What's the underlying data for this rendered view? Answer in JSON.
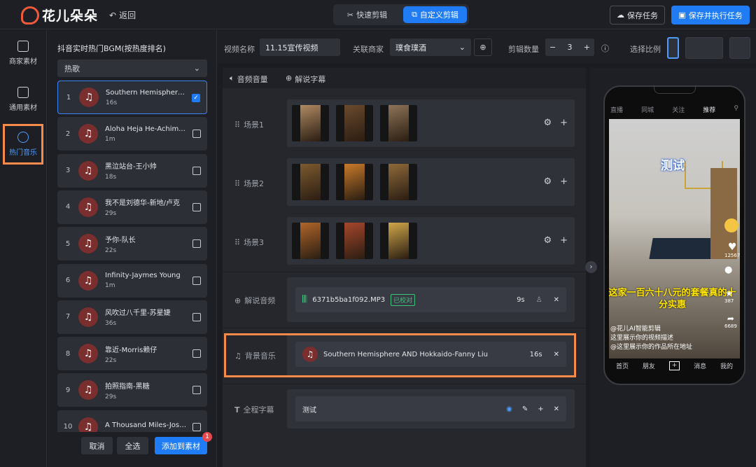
{
  "header": {
    "app_name": "花儿朵朵",
    "back_label": "返回",
    "mode_tabs": [
      {
        "label": "快速剪辑",
        "active": false
      },
      {
        "label": "自定义剪辑",
        "active": true
      }
    ],
    "save_label": "保存任务",
    "save_run_label": "保存并执行任务"
  },
  "nav": [
    {
      "label": "商家素材",
      "icon": "play-icon",
      "active": false
    },
    {
      "label": "通用素材",
      "icon": "video-icon",
      "active": false
    },
    {
      "label": "热门音乐",
      "icon": "music-disc-icon",
      "active": true
    }
  ],
  "music_panel": {
    "title": "抖音实时热门BGM(按热度排名)",
    "genre_value": "热歌",
    "tracks": [
      {
        "index": "1",
        "name": "Southern Hemisphere...",
        "duration": "16s",
        "checked": true
      },
      {
        "index": "2",
        "name": "Aloha Heja He-Achim...",
        "duration": "1m",
        "checked": false
      },
      {
        "index": "3",
        "name": "黑泣站台-王小帅",
        "duration": "18s",
        "checked": false
      },
      {
        "index": "4",
        "name": "我不是刘德华-新地/卢克",
        "duration": "29s",
        "checked": false
      },
      {
        "index": "5",
        "name": "予你-队长",
        "duration": "22s",
        "checked": false
      },
      {
        "index": "6",
        "name": "Infinity-Jaymes Young",
        "duration": "1m",
        "checked": false
      },
      {
        "index": "7",
        "name": "风吹过八千里-苏星婕",
        "duration": "36s",
        "checked": false
      },
      {
        "index": "8",
        "name": "靠近-Morris赖仔",
        "duration": "22s",
        "checked": false
      },
      {
        "index": "9",
        "name": "拍照指南-黑糖",
        "duration": "29s",
        "checked": false
      },
      {
        "index": "10",
        "name": "A Thousand Miles-Josh...",
        "duration": "",
        "checked": false
      }
    ],
    "cancel_label": "取消",
    "select_all_label": "全选",
    "add_label": "添加到素材",
    "add_badge": "1"
  },
  "toolbar": {
    "video_name_label": "视频名称",
    "video_name_value": "11.15宣传视频",
    "merchant_label": "关联商家",
    "merchant_value": "璞食璞酒",
    "count_label": "剪辑数量",
    "count_value": "3",
    "ratio_label": "选择比例"
  },
  "editor": {
    "tab_audio": "音频音量",
    "tab_subtitle": "解说字幕",
    "scenes": [
      {
        "label": "场景1"
      },
      {
        "label": "场景2"
      },
      {
        "label": "场景3"
      }
    ],
    "narration_label": "解说音频",
    "narration_file": "6371b5ba1f092.MP3",
    "narration_status": "已校对",
    "narration_duration": "9s",
    "bgm_label": "背景音乐",
    "bgm_name": "Southern Hemisphere AND Hokkaido-Fanny Liu",
    "bgm_duration": "16s",
    "subtitle_label": "全程字幕",
    "subtitle_value": "测试"
  },
  "preview": {
    "top_tabs": [
      "直播",
      "同城",
      "关注",
      "推荐"
    ],
    "title_text": "测试",
    "caption": "这家一百六十八元的套餐真的十分实惠",
    "author": "@花儿AI智能剪辑",
    "desc_lines": [
      "这里展示你的视频描述",
      "@这里展示你的作品所在地址"
    ],
    "side_counts": [
      "12567",
      "387",
      "6689"
    ],
    "bottom_tabs": [
      "首页",
      "朋友",
      "+",
      "消息",
      "我的"
    ]
  },
  "colors": {
    "accent": "#1f7cf5",
    "highlight": "#f58a4b",
    "disc": "#7a2e2e",
    "status": "#3cc47c"
  }
}
